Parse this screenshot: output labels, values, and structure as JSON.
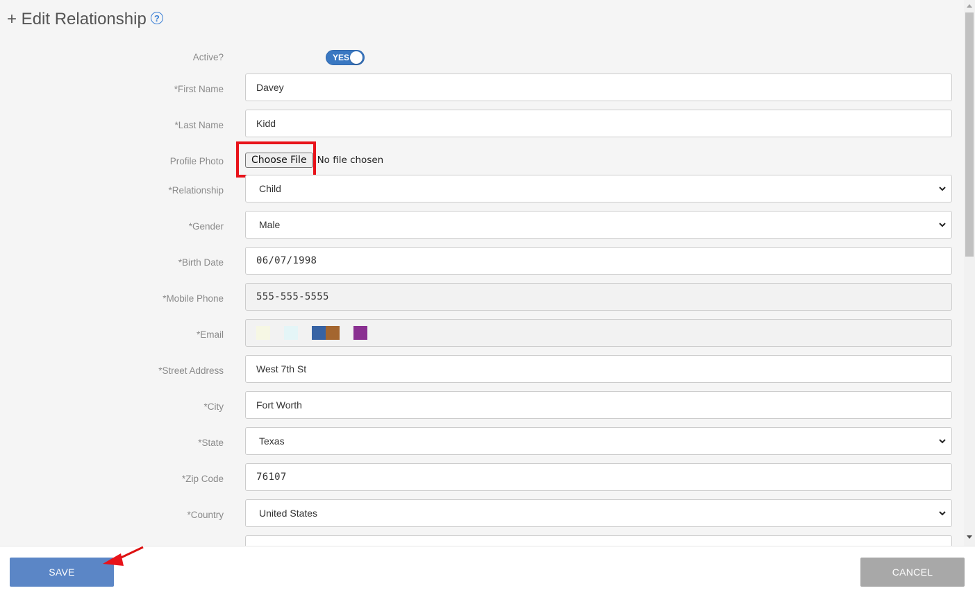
{
  "header": {
    "title": "+ Edit Relationship",
    "help_icon": "?"
  },
  "active": {
    "label": "Active?",
    "toggle_text": "YES"
  },
  "form": {
    "first_name": {
      "label": "*First Name",
      "value": "Davey"
    },
    "last_name": {
      "label": "*Last Name",
      "value": "Kidd"
    },
    "profile_photo": {
      "label": "Profile Photo",
      "button": "Choose File",
      "status": "No file chosen"
    },
    "relationship": {
      "label": "*Relationship",
      "value": "Child"
    },
    "gender": {
      "label": "*Gender",
      "value": "Male"
    },
    "birth_date": {
      "label": "*Birth Date",
      "value": "06/07/1998"
    },
    "mobile_phone": {
      "label": "*Mobile Phone",
      "value": "555-555-5555"
    },
    "email": {
      "label": "*Email",
      "swatch_colors": [
        "#f6f7e4",
        "#e4f5f7",
        "#3763a4",
        "#a4662f",
        "#8a3091"
      ]
    },
    "street_address": {
      "label": "*Street Address",
      "value": "West 7th St"
    },
    "city": {
      "label": "*City",
      "value": "Fort Worth"
    },
    "state": {
      "label": "*State",
      "value": "Texas"
    },
    "zip_code": {
      "label": "*Zip Code",
      "value": "76107"
    },
    "country": {
      "label": "*Country",
      "value": "United States"
    }
  },
  "footer": {
    "save_label": "SAVE",
    "cancel_label": "CANCEL"
  },
  "colors": {
    "accent": "#5b86c6",
    "highlight": "#e8131a",
    "toggle": "#3a78c2",
    "cancel": "#a8a8a8"
  }
}
